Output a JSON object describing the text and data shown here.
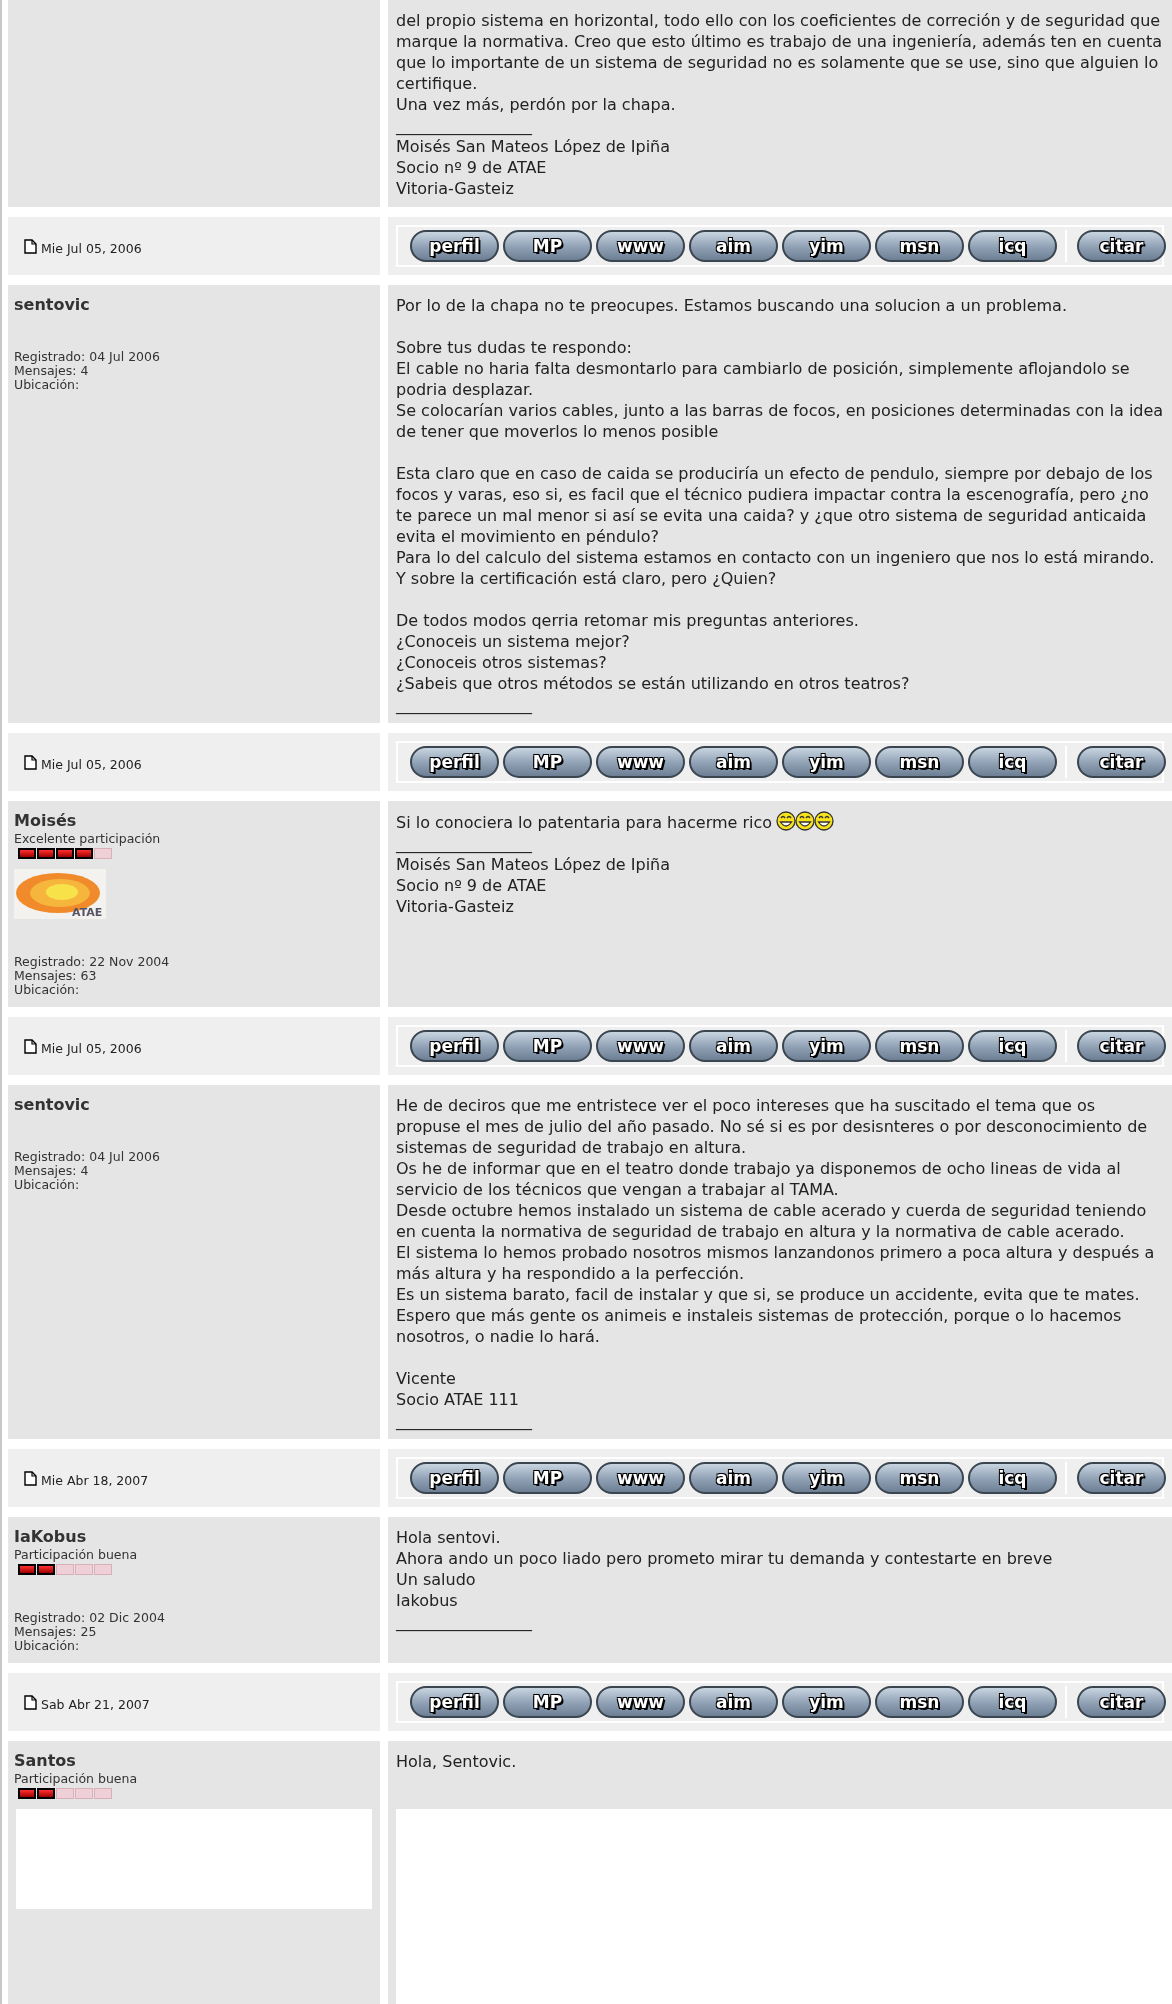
{
  "posts": [
    {
      "body": [
        [
          "del propio sistema en horizontal, todo ello con los coeficientes de correción y de seguridad que marque la normativa. Creo que esto último es trabajo de una ingeniería, además ten en cuenta que lo importante de un sistema de seguridad no es solamente que se use, sino que alguien lo certifique.",
          "Una vez más, perdón por la chapa.",
          "_________________",
          "Moisés San Mateos López de Ipiña",
          "Socio nº 9 de ATAE",
          "Vitoria-Gasteiz"
        ]
      ],
      "date": "Mie Jul 05, 2006",
      "buttons": [
        "perfil",
        "MP",
        "www",
        "aim",
        "yim",
        "msn",
        "icq"
      ],
      "quote_button": "citar"
    },
    {
      "author": {
        "name": "sentovic",
        "details": [
          "Registrado: 04 Jul 2006",
          "Mensajes: 4",
          "Ubicación:"
        ]
      },
      "body": [
        [
          "Por lo de la chapa no te preocupes. Estamos buscando una solucion a un problema."
        ],
        [
          "Sobre tus dudas te respondo:",
          "El cable no haria falta desmontarlo para cambiarlo de posición, simplemente aflojandolo se podria desplazar.",
          "Se colocarían varios cables, junto a las barras de focos, en posiciones determinadas con la idea de tener que moverlos lo menos posible"
        ],
        [
          "Esta claro que en caso de caida se produciría un efecto de pendulo, siempre por debajo de los focos y varas, eso si, es facil que el técnico pudiera impactar contra la escenografía, pero ¿no te parece un mal menor si así se evita una caida? y ¿que otro sistema de seguridad anticaida evita el movimiento en péndulo?",
          "Para lo del calculo del sistema estamos en contacto con un ingeniero que nos lo está mirando.",
          "Y sobre la certificación está claro, pero ¿Quien?"
        ],
        [
          "De todos modos qerria retomar mis preguntas anteriores.",
          "¿Conoceis un sistema mejor?",
          "¿Conoceis otros sistemas?",
          "¿Sabeis que otros métodos se están utilizando en otros teatros?",
          "_________________"
        ]
      ],
      "date": "Mie Jul 05, 2006",
      "buttons": [
        "perfil",
        "MP",
        "www",
        "aim",
        "yim",
        "msn",
        "icq"
      ],
      "quote_button": "citar"
    },
    {
      "author": {
        "name": "Moisés",
        "rank": "Excelente participación",
        "stars": 4,
        "avatar": {
          "caption": "ATAE"
        },
        "details": [
          "Registrado: 22 Nov 2004",
          "Mensajes: 63",
          "Ubicación:"
        ]
      },
      "body": [
        [
          "Si lo conociera lo patentaria para hacerme rico",
          "_________________",
          "Moisés San Mateos López de Ipiña",
          "Socio nº 9 de ATAE",
          "Vitoria-Gasteiz"
        ]
      ],
      "smileys": [
        {
          "kind": "laugh"
        },
        {
          "kind": "laugh"
        },
        {
          "kind": "laugh"
        }
      ],
      "date": "Mie Jul 05, 2006",
      "buttons": [
        "perfil",
        "MP",
        "www",
        "aim",
        "yim",
        "msn",
        "icq"
      ],
      "quote_button": "citar"
    },
    {
      "author": {
        "name": "sentovic",
        "details": [
          "Registrado: 04 Jul 2006",
          "Mensajes: 4",
          "Ubicación:"
        ]
      },
      "body": [
        [
          "He de deciros que me entristece ver el poco intereses que ha suscitado el tema que os propuse el mes de julio del año pasado. No sé si es por desisnteres o por desconocimiento de sistemas de seguridad de trabajo en altura.",
          "Os he de informar que en el teatro donde trabajo ya disponemos de ocho lineas de vida al servicio de los técnicos que vengan a trabajar al TAMA.",
          "Desde octubre hemos instalado un sistema de cable acerado y cuerda de seguridad teniendo en cuenta la normativa de seguridad de trabajo en altura y la normativa de cable acerado.",
          "El sistema lo hemos probado nosotros mismos lanzandonos primero a poca altura y después a más altura y ha respondido a la perfección.",
          "Es un sistema barato, facil de instalar y que si, se produce un accidente, evita que te mates.",
          "Espero que más gente os animeis e instaleis sistemas de protección, porque o lo hacemos nosotros, o nadie lo hará."
        ],
        [
          "Vicente",
          "Socio ATAE 111",
          "_________________"
        ]
      ],
      "date": "Mie Abr 18, 2007",
      "buttons": [
        "perfil",
        "MP",
        "www",
        "aim",
        "yim",
        "msn",
        "icq"
      ],
      "quote_button": "citar"
    },
    {
      "author": {
        "name": "IaKobus",
        "rank": "Participación buena",
        "stars": 2,
        "details": [
          "Registrado: 02 Dic 2004",
          "Mensajes: 25",
          "Ubicación:"
        ]
      },
      "body": [
        [
          "Hola sentovi.",
          "Ahora ando un poco liado pero prometo mirar tu demanda y contestarte en breve",
          "Un saludo",
          "Iakobus",
          "_________________"
        ]
      ],
      "date": "Sab Abr 21, 2007",
      "buttons": [
        "perfil",
        "MP",
        "www",
        "aim",
        "yim",
        "msn",
        "icq"
      ],
      "quote_button": "citar"
    },
    {
      "author": {
        "name": "Santos",
        "rank": "Participación buena",
        "stars": 2
      },
      "body": [
        [
          "Hola, Sentovic."
        ]
      ],
      "covered": true
    }
  ]
}
